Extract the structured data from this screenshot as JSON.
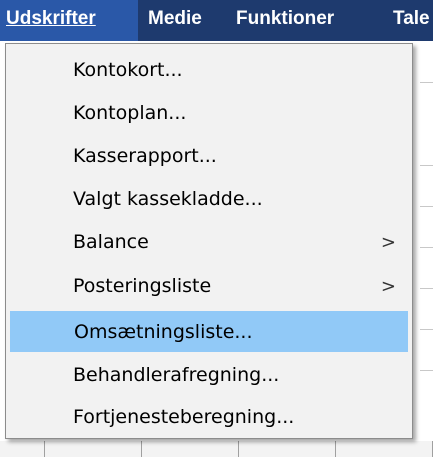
{
  "menubar": {
    "items": [
      {
        "label": "Udskrifter",
        "open": true
      },
      {
        "label": "Medie"
      },
      {
        "label": "Funktioner"
      },
      {
        "label": "Tale"
      }
    ]
  },
  "dropdown": {
    "items": [
      {
        "label": "Kontokort..."
      },
      {
        "label": "Kontoplan..."
      },
      {
        "label": "Kasserapport..."
      },
      {
        "label": "Valgt kassekladde..."
      },
      {
        "label": "Balance",
        "submenu_arrow": ">"
      },
      {
        "label": "Posteringsliste",
        "submenu_arrow": ">"
      },
      {
        "label": "Omsætningsliste...",
        "highlighted": true
      },
      {
        "label": "Behandlerafregning..."
      },
      {
        "label": "Fortjenesteberegning..."
      }
    ]
  },
  "colors": {
    "menubar_bg": "#1e3a6e",
    "menubar_open_bg": "#2a58a8",
    "dropdown_bg": "#f2f2f2",
    "highlight": "#91c9f7"
  }
}
